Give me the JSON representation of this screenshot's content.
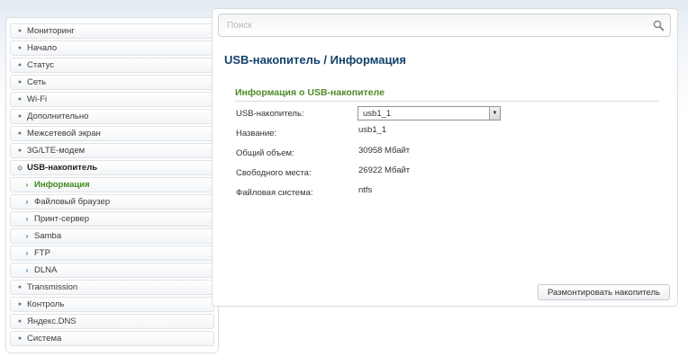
{
  "sidebar": {
    "items": [
      {
        "label": "Мониторинг",
        "icon": "chevron-circle-icon",
        "level": 0
      },
      {
        "label": "Начало",
        "icon": "chevron-circle-icon",
        "level": 0
      },
      {
        "label": "Статус",
        "icon": "chevron-circle-icon",
        "level": 0
      },
      {
        "label": "Сеть",
        "icon": "chevron-circle-icon",
        "level": 0
      },
      {
        "label": "Wi-Fi",
        "icon": "chevron-circle-icon",
        "level": 0
      },
      {
        "label": "Дополнительно",
        "icon": "chevron-circle-icon",
        "level": 0
      },
      {
        "label": "Межсетевой экран",
        "icon": "chevron-circle-icon",
        "level": 0
      },
      {
        "label": "3G/LTE-модем",
        "icon": "chevron-circle-icon",
        "level": 0
      },
      {
        "label": "USB-накопитель",
        "icon": "expanded-circle-icon",
        "level": 0,
        "expanded": true
      },
      {
        "label": "Информация",
        "icon": "arrow-right-icon",
        "level": 1,
        "active": true
      },
      {
        "label": "Файловый браузер",
        "icon": "arrow-right-icon",
        "level": 1
      },
      {
        "label": "Принт-сервер",
        "icon": "arrow-right-icon",
        "level": 1
      },
      {
        "label": "Samba",
        "icon": "arrow-right-icon",
        "level": 1
      },
      {
        "label": "FTP",
        "icon": "arrow-right-icon",
        "level": 1
      },
      {
        "label": "DLNA",
        "icon": "arrow-right-icon",
        "level": 1
      },
      {
        "label": "Transmission",
        "icon": "chevron-circle-icon",
        "level": 0
      },
      {
        "label": "Контроль",
        "icon": "chevron-circle-icon",
        "level": 0
      },
      {
        "label": "Яндекс.DNS",
        "icon": "chevron-circle-icon",
        "level": 0
      },
      {
        "label": "Система",
        "icon": "chevron-circle-icon",
        "level": 0
      }
    ]
  },
  "search": {
    "placeholder": "Поиск",
    "icon": "search-icon"
  },
  "main": {
    "title": "USB-накопитель /  Информация",
    "section_title": "Информация о USB-накопителе",
    "fields": {
      "drive_label": "USB-накопитель:",
      "drive_value": "usb1_1",
      "name_label": "Название:",
      "name_value": "usb1_1",
      "total_label": "Общий объем:",
      "total_value": "30958 Мбайт",
      "free_label": "Свободного места:",
      "free_value": "26922 Мбайт",
      "fs_label": "Файловая система:",
      "fs_value": "ntfs"
    },
    "unmount_button": "Размонтировать накопитель"
  },
  "colors": {
    "title": "#12416b",
    "section_title": "#4d8a27",
    "active_item": "#3e8a1d",
    "sub_arrow": "#1f6fb2"
  }
}
